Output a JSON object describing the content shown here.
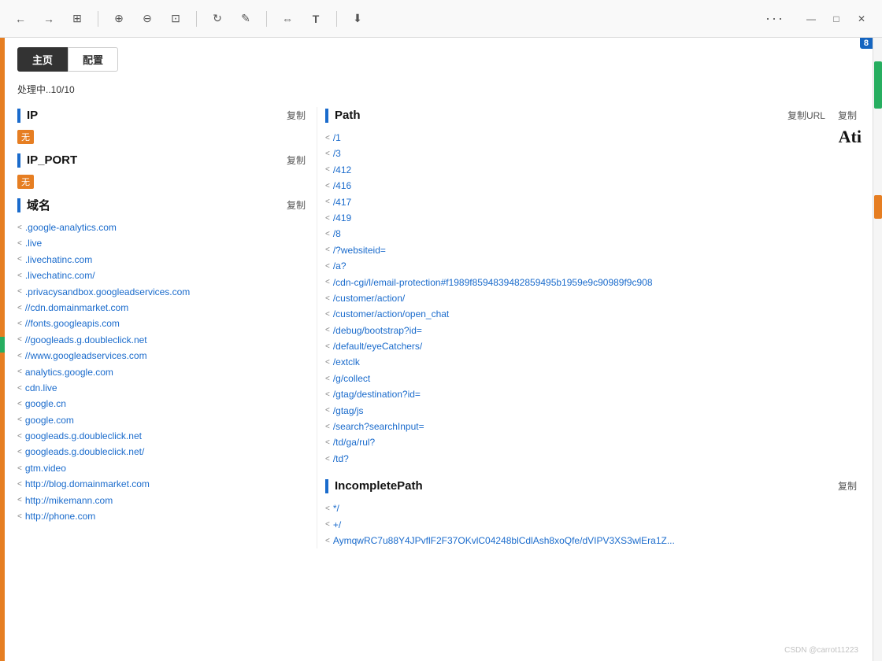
{
  "browser": {
    "nav_back": "←",
    "nav_forward": "→",
    "grid_icon": "⊞",
    "zoom_in": "⊕",
    "zoom_out": "⊖",
    "fit": "⊡",
    "rotate": "↻",
    "edit": "✎",
    "mirror": "⇔",
    "text": "T",
    "download": "⬇",
    "dots": "···",
    "minimize": "—",
    "maximize": "□",
    "close": "✕"
  },
  "tabs": {
    "main_label": "主页",
    "config_label": "配置"
  },
  "status": "处理中..10/10",
  "ip_section": {
    "title": "IP",
    "copy_label": "复制",
    "badge": "无"
  },
  "ip_port_section": {
    "title": "IP_PORT",
    "copy_label": "复制",
    "badge": "无"
  },
  "domain_section": {
    "title": "域名",
    "copy_label": "复制",
    "domains": [
      ".google-analytics.com",
      ".live",
      ".livechatinc.com",
      ".livechatinc.com/",
      ".privacysandbox.googleadservices.com",
      "//cdn.domainmarket.com",
      "//fonts.googleapis.com",
      "//googleads.g.doubleclick.net",
      "//www.googleadservices.com",
      "analytics.google.com",
      "cdn.live",
      "google.cn",
      "google.com",
      "googleads.g.doubleclick.net",
      "googleads.g.doubleclick.net/",
      "gtm.video",
      "http://blog.domainmarket.com",
      "http://mikemann.com",
      "http://phone.com"
    ]
  },
  "path_section": {
    "title": "Path",
    "copy_url_label": "复制URL",
    "copy_label": "复制",
    "paths": [
      "/1",
      "/3",
      "/412",
      "/416",
      "/417",
      "/419",
      "/8",
      "/?websiteid=",
      "/a?",
      "/cdn-cgi/l/email-protection#f1989f8594839482859495b1959e9c90989f9c908",
      "/customer/action/",
      "/customer/action/open_chat",
      "/debug/bootstrap?id=",
      "/default/eyeCatchers/",
      "/extclk",
      "/g/collect",
      "/gtag/destination?id=",
      "/gtag/js",
      "/search?searchInput=",
      "/td/ga/rul?",
      "/td?"
    ]
  },
  "incomplete_path_section": {
    "title": "IncompletePath",
    "copy_label": "复制",
    "paths": [
      "*/",
      "+/",
      "AymqwRC7u88Y4JPvflF2F37OKvlC04248blCdlAsh8xoQfe/dVIPV3XS3wlEra1Z..."
    ]
  },
  "blue_badge": "8",
  "watermark": "CSDN @carrot11223"
}
